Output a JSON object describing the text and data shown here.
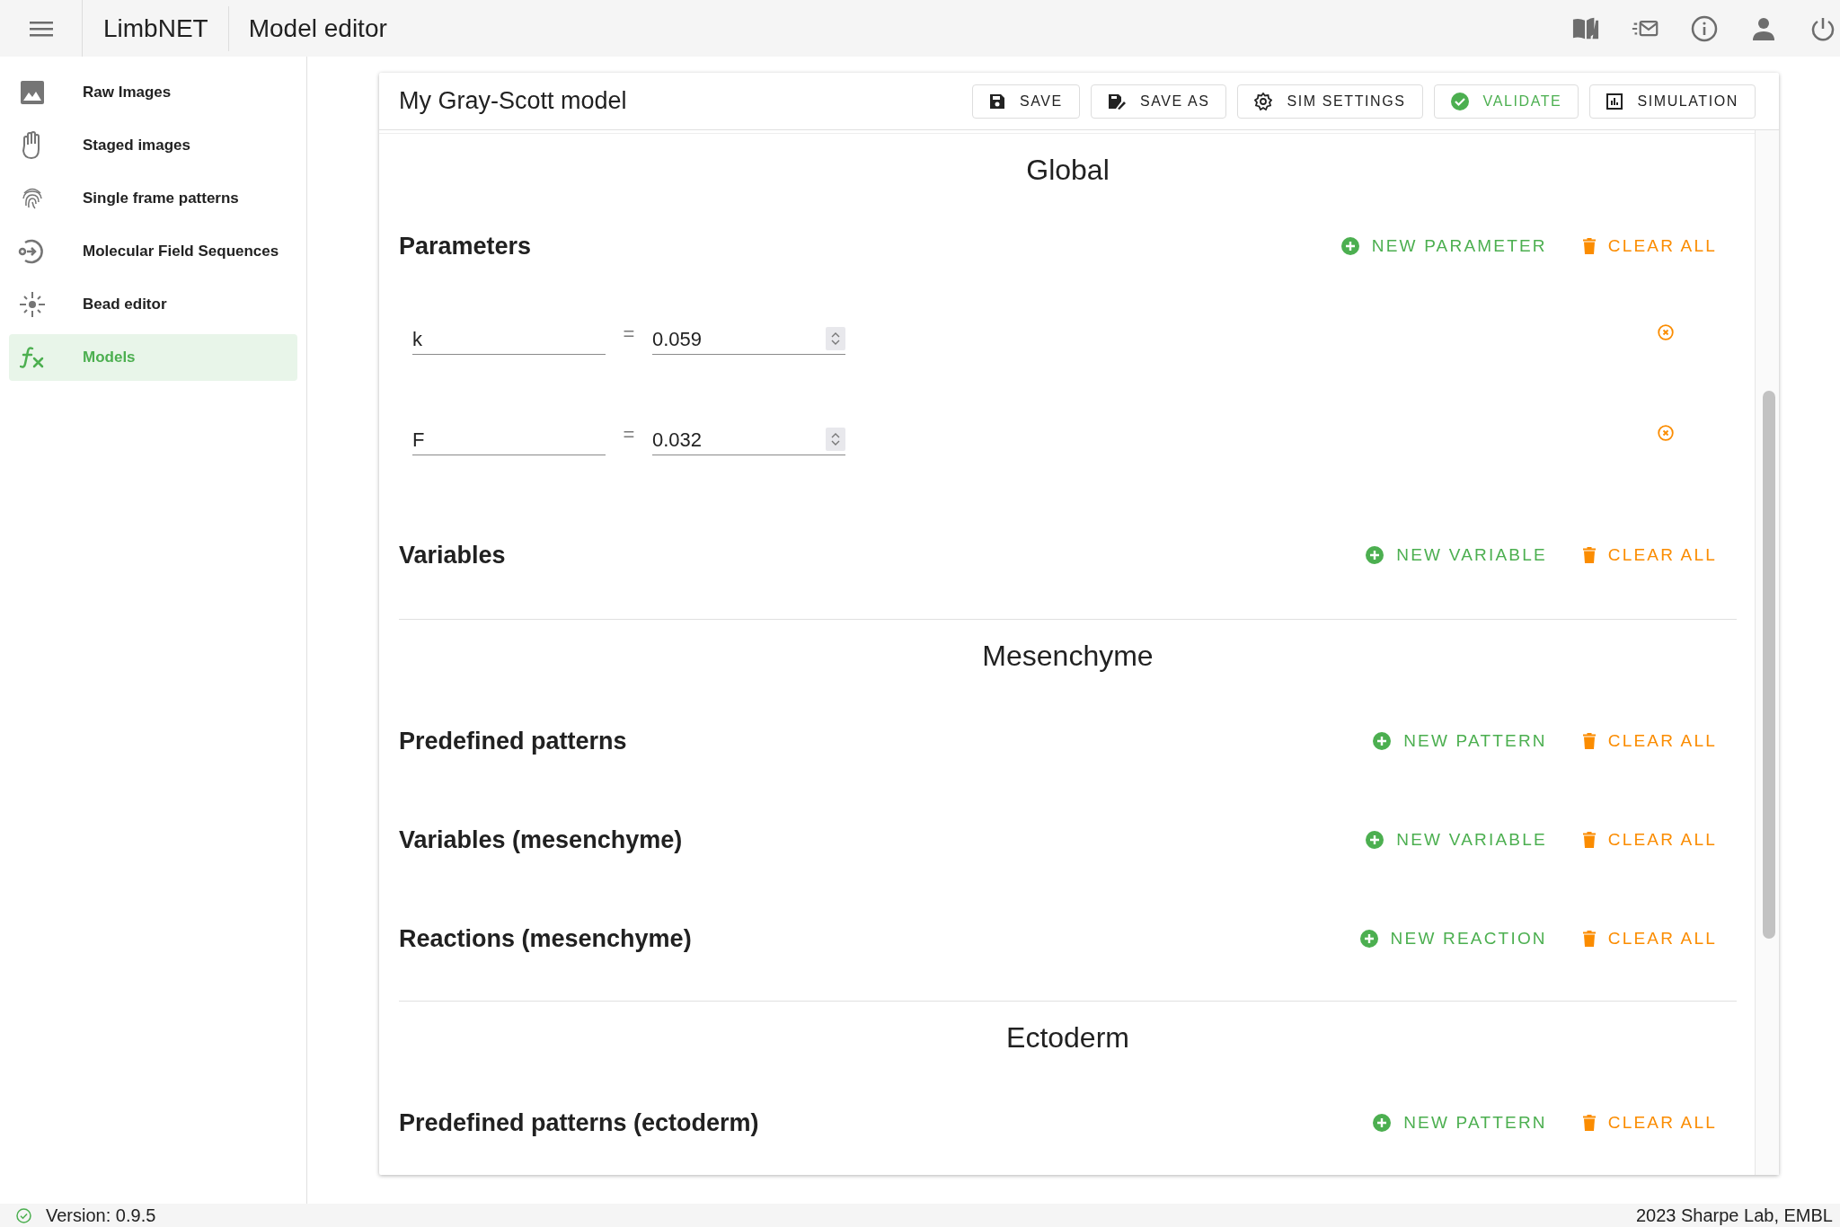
{
  "app_bar": {
    "title": "LimbNET",
    "page": "Model editor"
  },
  "sidebar": {
    "items": [
      {
        "label": "Raw Images",
        "selected": false
      },
      {
        "label": "Staged images",
        "selected": false
      },
      {
        "label": "Single frame patterns",
        "selected": false
      },
      {
        "label": "Molecular Field Sequences",
        "selected": false
      },
      {
        "label": "Bead editor",
        "selected": false
      },
      {
        "label": "Models",
        "selected": true
      }
    ]
  },
  "model": {
    "title": "My Gray-Scott model",
    "toolbar": [
      {
        "label": "SAVE",
        "kind": "save"
      },
      {
        "label": "SAVE AS",
        "kind": "save-as"
      },
      {
        "label": "SIM SETTINGS",
        "kind": "settings"
      },
      {
        "label": "VALIDATE",
        "kind": "validate"
      },
      {
        "label": "SIMULATION",
        "kind": "simulation"
      }
    ],
    "groups": [
      {
        "title": "Global",
        "sections": [
          {
            "title": "Parameters",
            "add_label": "NEW PARAMETER",
            "clear_label": "CLEAR ALL",
            "parameters": [
              {
                "name": "k",
                "operator": "=",
                "value": "0.059"
              },
              {
                "name": "F",
                "operator": "=",
                "value": "0.032"
              }
            ]
          },
          {
            "title": "Variables",
            "add_label": "NEW VARIABLE",
            "clear_label": "CLEAR ALL"
          }
        ]
      },
      {
        "title": "Mesenchyme",
        "sections": [
          {
            "title": "Predefined patterns",
            "add_label": "NEW PATTERN",
            "clear_label": "CLEAR ALL"
          },
          {
            "title": "Variables (mesenchyme)",
            "add_label": "NEW VARIABLE",
            "clear_label": "CLEAR ALL"
          },
          {
            "title": "Reactions (mesenchyme)",
            "add_label": "NEW REACTION",
            "clear_label": "CLEAR ALL"
          }
        ]
      },
      {
        "title": "Ectoderm",
        "sections": [
          {
            "title": "Predefined patterns (ectoderm)",
            "add_label": "NEW PATTERN",
            "clear_label": "CLEAR ALL"
          }
        ]
      }
    ]
  },
  "status_bar": {
    "version": "Version: 0.9.5",
    "credit": "2023 Sharpe Lab, EMBL"
  }
}
